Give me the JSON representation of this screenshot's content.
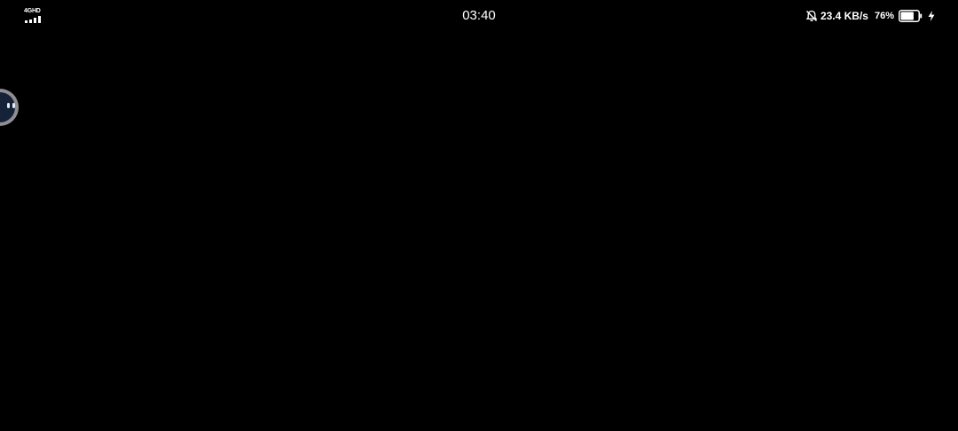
{
  "status_bar": {
    "network_type": "4GHD",
    "time": "03:40",
    "net_speed": "23.4 KB/s",
    "battery_percent": "76%",
    "battery_level": 0.76,
    "icons": {
      "signal": "signal-bars-icon",
      "mute": "bell-off-icon",
      "battery": "battery-icon",
      "charging": "lightning-bolt-icon"
    }
  },
  "floating_assistant": {
    "icon": "robot-face-icon",
    "colors": {
      "ring": "#8e8e93",
      "face": "#152238"
    }
  },
  "screen": {
    "background": "#000000"
  }
}
